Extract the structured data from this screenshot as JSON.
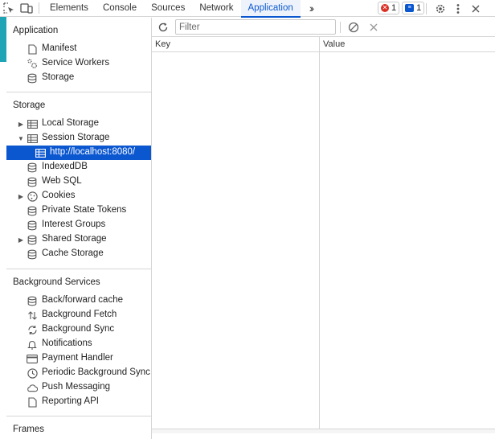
{
  "tabs": [
    "Elements",
    "Console",
    "Sources",
    "Network",
    "Application"
  ],
  "active_tab": "Application",
  "badges": {
    "errors": "1",
    "messages": "1"
  },
  "sidebar": {
    "application": {
      "title": "Application",
      "items": [
        {
          "label": "Manifest",
          "icon": "file-icon"
        },
        {
          "label": "Service Workers",
          "icon": "gears-icon"
        },
        {
          "label": "Storage",
          "icon": "database-icon"
        }
      ]
    },
    "storage": {
      "title": "Storage",
      "items": [
        {
          "label": "Local Storage",
          "icon": "table-icon",
          "expander": "collapsed"
        },
        {
          "label": "Session Storage",
          "icon": "table-icon",
          "expander": "expanded"
        },
        {
          "label": "http://localhost:8080/",
          "icon": "table-icon",
          "selected": true
        },
        {
          "label": "IndexedDB",
          "icon": "database-icon"
        },
        {
          "label": "Web SQL",
          "icon": "database-icon"
        },
        {
          "label": "Cookies",
          "icon": "cookie-icon",
          "expander": "collapsed"
        },
        {
          "label": "Private State Tokens",
          "icon": "database-icon"
        },
        {
          "label": "Interest Groups",
          "icon": "database-icon"
        },
        {
          "label": "Shared Storage",
          "icon": "database-icon",
          "expander": "collapsed"
        },
        {
          "label": "Cache Storage",
          "icon": "database-icon"
        }
      ]
    },
    "background_services": {
      "title": "Background Services",
      "items": [
        {
          "label": "Back/forward cache",
          "icon": "database-icon"
        },
        {
          "label": "Background Fetch",
          "icon": "up-down-arrows-icon"
        },
        {
          "label": "Background Sync",
          "icon": "sync-icon"
        },
        {
          "label": "Notifications",
          "icon": "bell-icon"
        },
        {
          "label": "Payment Handler",
          "icon": "card-icon"
        },
        {
          "label": "Periodic Background Sync",
          "icon": "clock-icon"
        },
        {
          "label": "Push Messaging",
          "icon": "cloud-icon"
        },
        {
          "label": "Reporting API",
          "icon": "file-icon"
        }
      ]
    },
    "frames": {
      "title": "Frames"
    }
  },
  "main": {
    "filter_placeholder": "Filter",
    "columns": [
      "Key",
      "Value"
    ]
  },
  "colors": {
    "accent": "#0b57d0",
    "teal": "#1fa4b6",
    "error": "#d93025"
  }
}
